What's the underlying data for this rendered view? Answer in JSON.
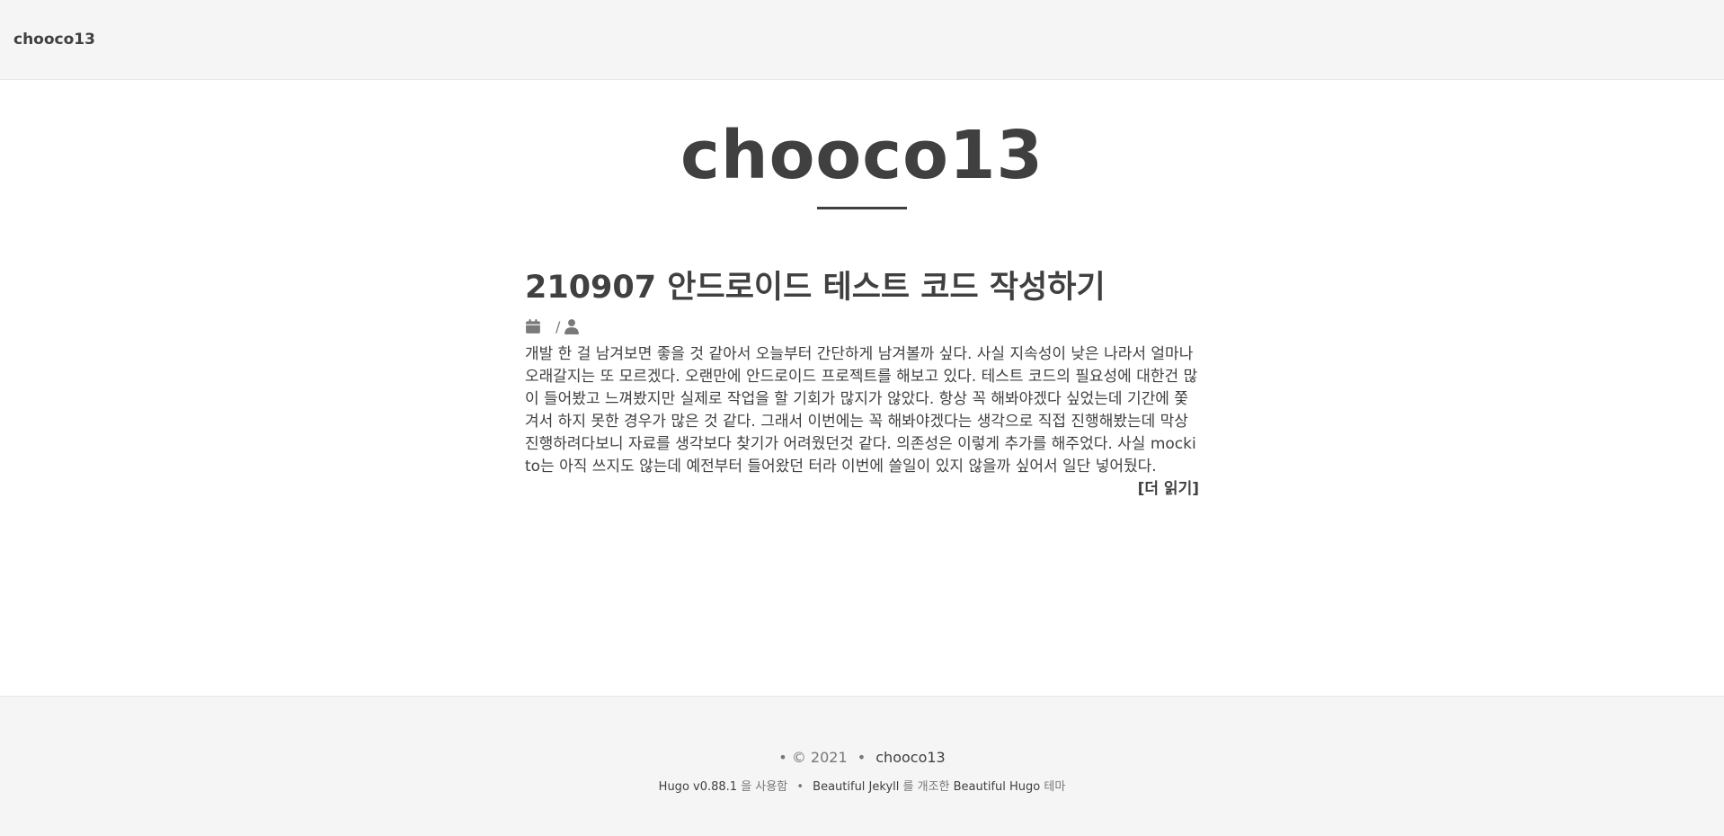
{
  "navbar": {
    "brand": "chooco13"
  },
  "header": {
    "title": "chooco13"
  },
  "posts": [
    {
      "title": "210907 안드로이드 테스트 코드 작성하기",
      "meta": {
        "separator": "/",
        "date_icon": "calendar-icon",
        "author_icon": "user-icon"
      },
      "excerpt": "개발 한 걸 남겨보면 좋을 것 같아서 오늘부터 간단하게 남겨볼까 싶다. 사실 지속성이 낮은 나라서 얼마나 오래갈지는 또 모르겠다. 오랜만에 안드로이드 프로젝트를 해보고 있다. 테스트 코드의 필요성에 대한건 많이 들어봤고 느껴봤지만 실제로 작업을 할 기회가 많지가 않았다. 항상 꼭 해봐야겠다 싶었는데 기간에 쫓겨서 하지 못한 경우가 많은 것 같다. 그래서 이번에는 꼭 해봐야겠다는 생각으로 직접 진행해봤는데 막상 진행하려다보니 자료를 생각보다 찾기가 어려웠던것 같다. 의존성은 이렇게 추가를 해주었다. 사실 mockito는 아직 쓰지도 않는데 예전부터 들어왔던 터라 이번에 쓸일이 있지 않을까 싶어서 일단 넣어뒀다.",
      "read_more": "[더 읽기]"
    }
  ],
  "footer": {
    "bullet": "•",
    "copyright": "© 2021",
    "author": "chooco13",
    "hugo_link": "Hugo v0.88.1",
    "hugo_suffix": "을 사용함",
    "jekyll_link": "Beautiful Jekyll",
    "jekyll_suffix": "를 개조한",
    "theme_link": "Beautiful Hugo",
    "theme_suffix": "테마"
  },
  "colors": {
    "text": "#404040",
    "muted": "#777777",
    "bar_background": "#f5f5f5"
  }
}
